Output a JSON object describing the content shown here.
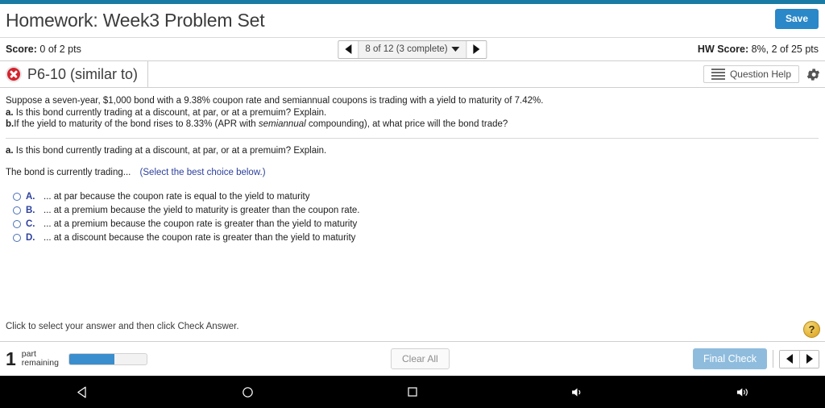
{
  "header": {
    "title": "Homework: Week3 Problem Set",
    "save_label": "Save"
  },
  "score_bar": {
    "score_label": "Score:",
    "score_value": "0 of 2 pts",
    "nav_prev_icon": "triangle-left-icon",
    "nav_next_icon": "triangle-right-icon",
    "question_selector": "8 of 12 (3 complete)",
    "hw_score_label": "HW Score:",
    "hw_score_value": "8%, 2 of 25 pts"
  },
  "problem_header": {
    "status_icon": "red-x-icon",
    "problem_id": "P6-10 (similar to)",
    "question_help_label": "Question Help",
    "help_list_icon": "list-icon",
    "settings_icon": "gear-icon"
  },
  "problem": {
    "stem_line1": "Suppose a seven-year, $1,000 bond with a 9.38% coupon rate and semiannual coupons is trading with a yield to maturity of 7.42%.",
    "part_a_label": "a.",
    "part_a_text": "Is this bond currently trading at a discount, at par, or at a premuim? Explain.",
    "part_b_label": "b.",
    "part_b_text_pre": "If the yield to maturity of the bond rises to 8.33% (APR with ",
    "part_b_text_em": "semiannual",
    "part_b_text_post": " compounding), at what price will the bond trade?",
    "restate_label": "a.",
    "restate_text": "Is this bond currently trading at a discount, at par, or at a premuim? Explain.",
    "prompt": "The bond is currently trading...",
    "hint": "(Select the best choice below.)",
    "choices": [
      {
        "letter": "A.",
        "text": "... at par because the coupon rate is equal to the yield to maturity"
      },
      {
        "letter": "B.",
        "text": "... at a premium because the yield to maturity is greater than the coupon rate."
      },
      {
        "letter": "C.",
        "text": "... at a premium because the coupon rate is greater than the yield to maturity"
      },
      {
        "letter": "D.",
        "text": "... at a discount because the coupon rate is greater than the yield to maturity"
      }
    ]
  },
  "footer": {
    "instruction": "Click to select your answer and then click Check Answer.",
    "help_badge": "?",
    "parts_number": "1",
    "parts_label_line1": "part",
    "parts_label_line2": "remaining",
    "progress_percent": 58,
    "clear_all_label": "Clear All",
    "final_check_label": "Final Check",
    "pager_prev_icon": "triangle-left-icon",
    "pager_next_icon": "triangle-right-icon"
  },
  "android_nav": {
    "back_icon": "back-triangle-icon",
    "home_icon": "home-circle-icon",
    "recents_icon": "recents-square-icon",
    "volume_down_icon": "volume-down-icon",
    "volume_up_icon": "volume-up-icon"
  },
  "colors": {
    "accent_blue": "#1a7ba4",
    "save_blue": "#2a87c8",
    "link_blue": "#2b3f9c",
    "progress_blue": "#3b8ecd",
    "final_check_blue": "#8fbcdd",
    "error_red": "#d5232d",
    "help_gold": "#e0ad2e"
  }
}
